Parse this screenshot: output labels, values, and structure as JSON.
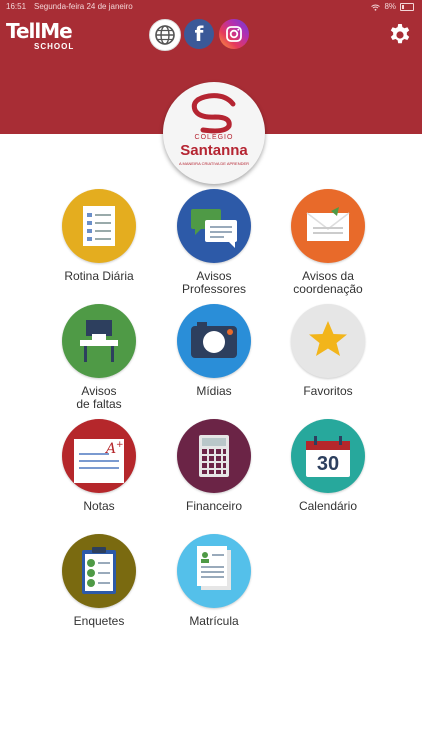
{
  "status_bar": {
    "time": "16:51",
    "date": "Segunda-feira 24 de janeiro",
    "battery": "8%"
  },
  "header": {
    "brand": "TellMe",
    "brand_sub": "SCHOOL",
    "background": "#a82d35"
  },
  "school": {
    "line1": "COLÉGIO",
    "name": "Santanna",
    "tagline": "A MANEIRA CRIATIVA DE APRENDER"
  },
  "tiles": [
    {
      "label": "Rotina Diária",
      "icon": "checklist-icon",
      "color": "#e4ad1f"
    },
    {
      "label": "Avisos\nProfessores",
      "icon": "chat-bubbles-icon",
      "color": "#2d5aa8"
    },
    {
      "label": "Avisos da\ncoordenação",
      "icon": "envelope-icon",
      "color": "#e86a2a"
    },
    {
      "label": "Avisos\nde faltas",
      "icon": "desk-chair-icon",
      "color": "#4f9a46"
    },
    {
      "label": "Mídias",
      "icon": "camera-icon",
      "color": "#2a8ed8"
    },
    {
      "label": "Favoritos",
      "icon": "star-icon",
      "color": "#e6e6e6"
    },
    {
      "label": "Notas",
      "icon": "graded-paper-icon",
      "color": "#b5272b"
    },
    {
      "label": "Financeiro",
      "icon": "calculator-icon",
      "color": "#6b2446"
    },
    {
      "label": "Calendário",
      "icon": "calendar-icon",
      "color": "#27a89c",
      "day": "30"
    },
    {
      "label": "Enquetes",
      "icon": "clipboard-icon",
      "color": "#7a6a10"
    },
    {
      "label": "Matrícula",
      "icon": "enrollment-document-icon",
      "color": "#54c0ea"
    }
  ]
}
